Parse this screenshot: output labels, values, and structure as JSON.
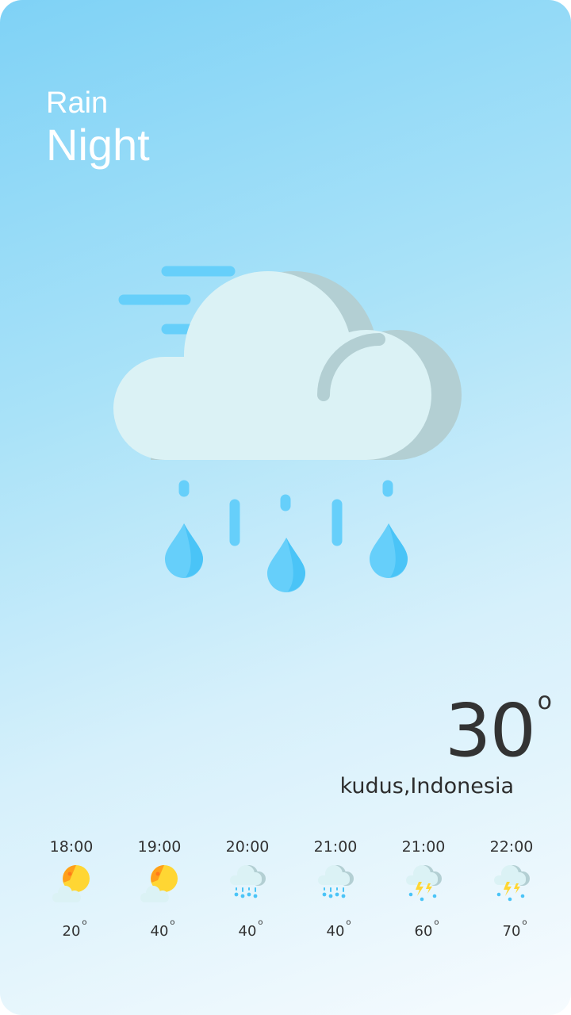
{
  "condition": {
    "line1": "Rain",
    "line2": "Night"
  },
  "current": {
    "temperature": "30",
    "degree_symbol": "o",
    "location": "kudus,Indonesia"
  },
  "hero_icon": "rain-cloud-icon",
  "colors": {
    "cloud": "#dbf2f5",
    "cloud_shade": "#b3cfd3",
    "drop": "#66cffa",
    "drop_dark": "#4ac4f7",
    "wind": "#66cffa"
  },
  "forecast": [
    {
      "time": "18:00",
      "temp": "20",
      "degree": "o",
      "icon": "partly-cloudy-sun-icon"
    },
    {
      "time": "19:00",
      "temp": "40",
      "degree": "o",
      "icon": "partly-cloudy-sun-icon"
    },
    {
      "time": "20:00",
      "temp": "40",
      "degree": "o",
      "icon": "rain-cloud-icon"
    },
    {
      "time": "21:00",
      "temp": "40",
      "degree": "o",
      "icon": "rain-cloud-icon"
    },
    {
      "time": "21:00",
      "temp": "60",
      "degree": "o",
      "icon": "thunderstorm-icon"
    },
    {
      "time": "22:00",
      "temp": "70",
      "degree": "o",
      "icon": "thunderstorm-icon"
    }
  ]
}
